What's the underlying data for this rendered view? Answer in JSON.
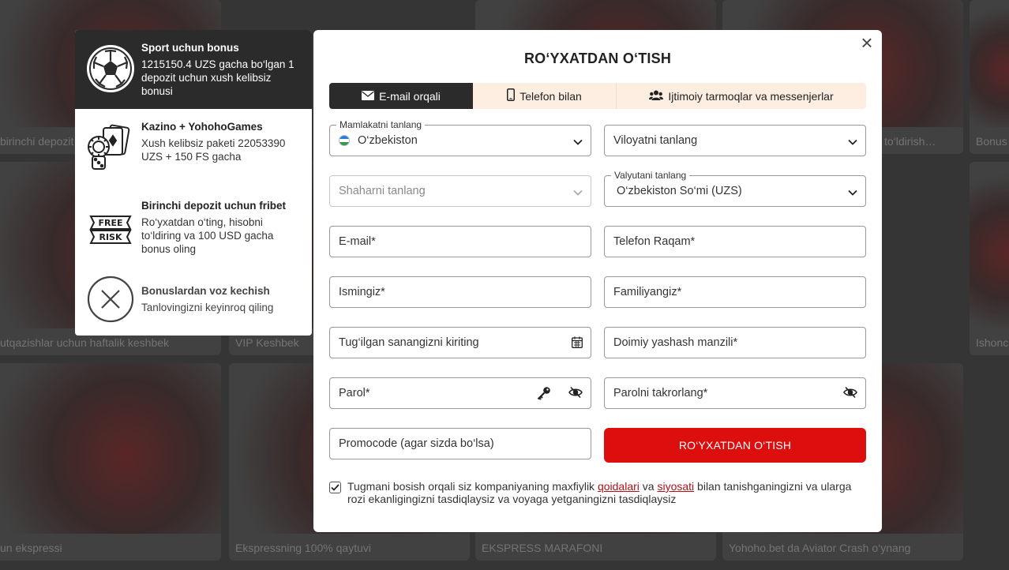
{
  "background": {
    "captions": [
      "birinchi depozit u",
      "to‘ldirish…",
      "Bonus",
      "utqazishlar uchun haftalik keshbek",
      "VIP Keshbek",
      "Ishonc",
      "un ekspressi",
      "Ekspressning 100% qaytuvi",
      "EKSPRESS MARAFONI",
      "Yohoho.bet da Aviator Crash o‘ynang"
    ]
  },
  "bonuses": [
    {
      "title": "Sport uchun bonus",
      "desc": "1215150.4 UZS gacha bo‘lgan 1 depozit uchun xush kelibsiz bonusi",
      "icon": "soccer-ball-icon",
      "selected": true
    },
    {
      "title": "Kazino + YohohoGames",
      "desc": "Xush kelibsiz paketi 22053390 UZS + 150 FS gacha",
      "icon": "casino-chips-icon",
      "selected": false
    },
    {
      "title": "Birinchi depozit uchun fribet",
      "desc": "Ro‘yxatdan o‘ting, hisobni to‘ldiring va 100 USD gacha bonus oling",
      "icon": "free-risk-icon",
      "icon_top": "FREE",
      "icon_bottom": "RISK",
      "selected": false
    },
    {
      "title": "Bonuslardan voz kechish",
      "desc": "Tanlovingizni keyinroq qiling",
      "icon": "decline-x-icon",
      "selected": false
    }
  ],
  "modal": {
    "title": "RO‘YXATDAN O‘TISH",
    "close": "×",
    "tabs": [
      {
        "label": "E-mail orqali",
        "icon": "envelope-icon",
        "active": true
      },
      {
        "label": "Telefon bilan",
        "icon": "phone-icon",
        "active": false
      },
      {
        "label": "Ijtimoiy tarmoqlar va messenjerlar",
        "icon": "users-icon",
        "active": false
      }
    ],
    "fields": {
      "country_label": "Mamlakatni tanlang",
      "country_value": "O‘zbekiston",
      "region_placeholder": "Viloyatni tanlang",
      "city_placeholder": "Shaharni tanlang",
      "currency_label": "Valyutani tanlang",
      "currency_value": "O‘zbekiston So‘mi (UZS)",
      "email_placeholder": "E-mail*",
      "phone_placeholder": "Telefon Raqam*",
      "name_placeholder": "Ismingiz*",
      "surname_placeholder": "Familiyangiz*",
      "birthdate_placeholder": "Tug‘ilgan sanangizni kiriting",
      "address_placeholder": "Doimiy yashash manzili*",
      "password_placeholder": "Parol*",
      "password_repeat_placeholder": "Parolni takrorlang*",
      "promocode_placeholder": "Promocode (agar sizda bo‘lsa)"
    },
    "submit_label": "RO‘YXATDAN O‘TISH",
    "consent": {
      "checked": true,
      "text_before": "Tugmani bosish orqali siz kompaniyaning maxfiylik ",
      "link1": "qoidalari",
      "text_mid": " va ",
      "link2": "siyosati",
      "text_after": " bilan tanishganingizni va ularga rozi ekanligingizni tasdiqlaysiz va voyaga yetganingizni tasdiqlaysiz"
    }
  },
  "colors": {
    "accent_red": "#dc0e0e",
    "tab_active": "#2b2b2b",
    "tab_bg": "#fdeee1",
    "link": "#b0101a"
  }
}
